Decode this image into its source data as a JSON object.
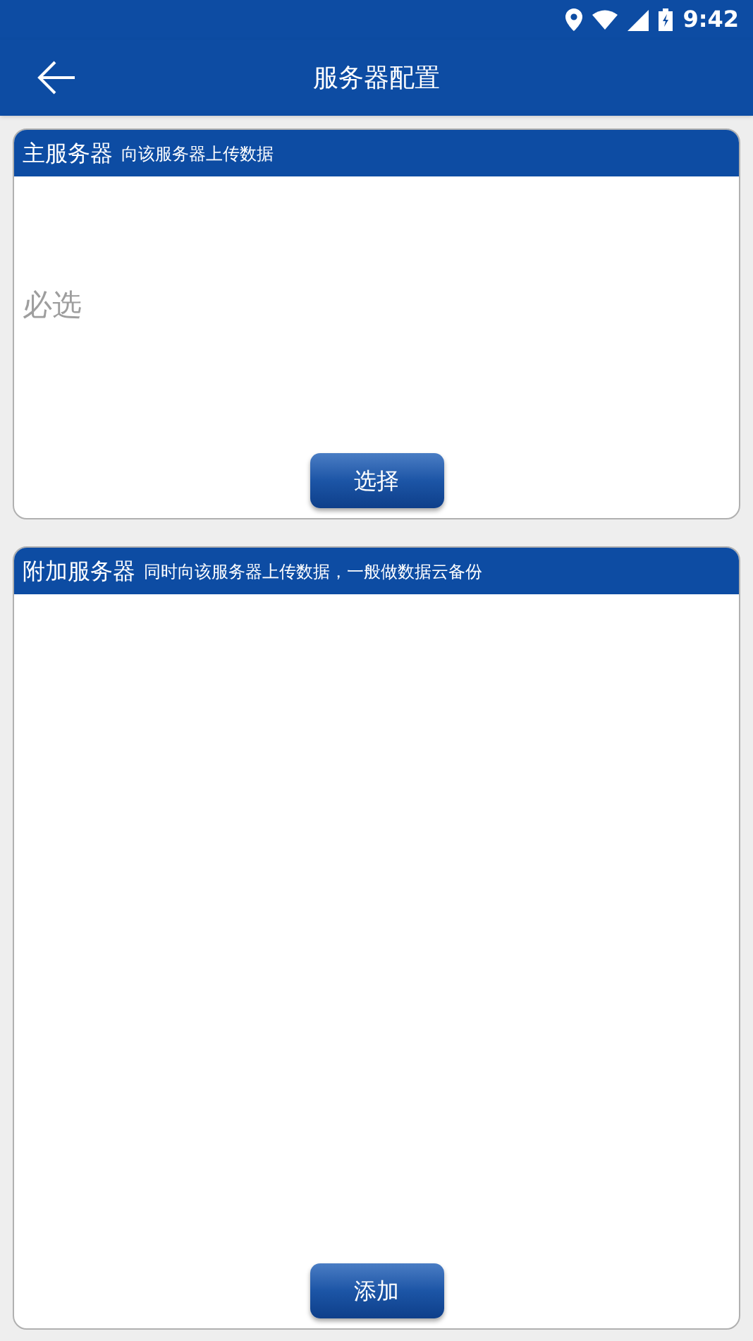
{
  "status_bar": {
    "time": "9:42"
  },
  "app_bar": {
    "title": "服务器配置"
  },
  "sections": [
    {
      "kind": "primary",
      "title": "主服务器",
      "subtitle": "向该服务器上传数据",
      "placeholder": "必选",
      "button": "选择"
    },
    {
      "kind": "extra",
      "title": "附加服务器",
      "subtitle": "同时向该服务器上传数据，一般做数据云备份",
      "button": "添加"
    }
  ]
}
